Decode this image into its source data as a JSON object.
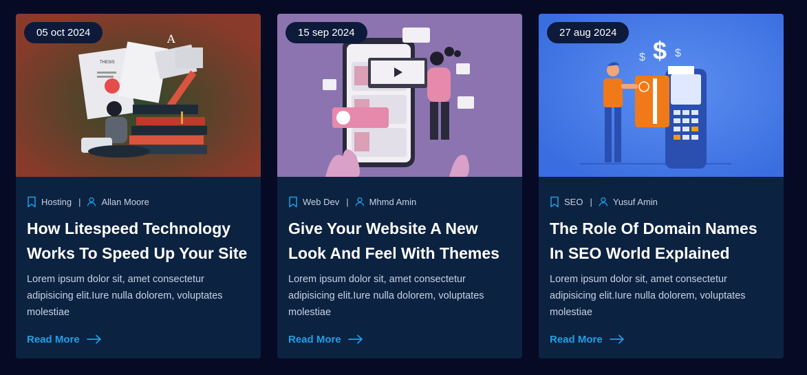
{
  "colors": {
    "page_bg": "#070a24",
    "card_bg": "#0c2241",
    "accent": "#1ea0e6",
    "date_badge_bg": "#0d1a3a"
  },
  "posts": [
    {
      "date": "05 oct 2024",
      "category": "Hosting",
      "author": "Allan Moore",
      "title": "How Litespeed Technology Works To Speed Up Your Site",
      "excerpt": "Lorem ipsum dolor sit, amet consectetur adipisicing elit.Iure nulla dolorem, voluptates molestiae",
      "read_more": "Read More",
      "image_texts": [
        "A",
        "THESIS"
      ]
    },
    {
      "date": "15 sep 2024",
      "category": "Web Dev",
      "author": "Mhmd Amin",
      "title": "Give Your Website A New Look And Feel With Themes",
      "excerpt": "Lorem ipsum dolor sit, amet consectetur adipisicing elit.Iure nulla dolorem, voluptates molestiae",
      "read_more": "Read More"
    },
    {
      "date": "27 aug 2024",
      "category": "SEO",
      "author": "Yusuf Amin",
      "title": "The Role Of Domain Names In SEO World Explained",
      "excerpt": "Lorem ipsum dolor sit, amet consectetur adipisicing elit.Iure nulla dolorem, voluptates molestiae",
      "read_more": "Read More",
      "image_texts": [
        "$",
        "$",
        "$"
      ]
    }
  ],
  "icons": {
    "category": "bookmark-icon",
    "author": "user-icon",
    "read_more": "arrow-right-icon"
  }
}
